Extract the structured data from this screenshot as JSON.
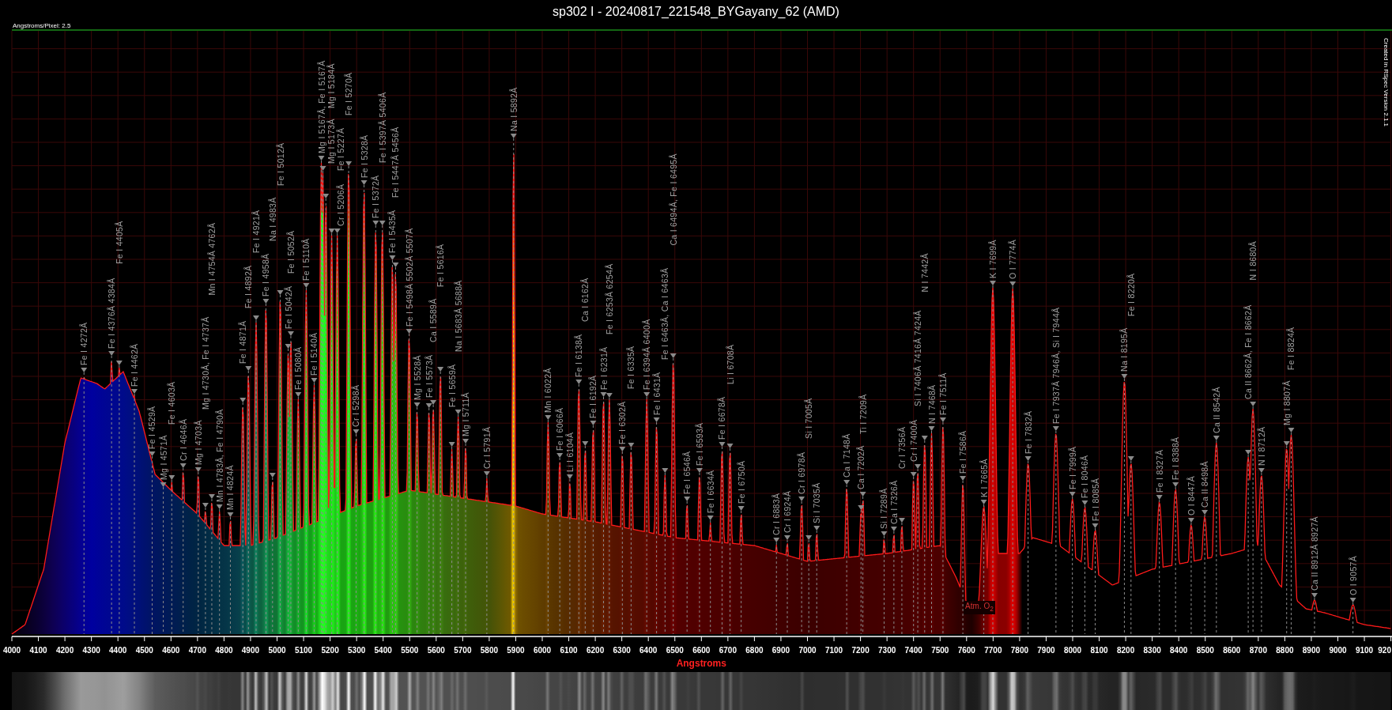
{
  "title": "sp302 I - 20240817_221548_BYGayany_62 (AMD)",
  "scale_note": "Angstroms/Pixel: 2.5",
  "credit": "Created in RSpec Version 2.1.1",
  "spectrum": {
    "xlabel": "Angstroms",
    "x_ticks": [
      "4000",
      "4100",
      "4200",
      "4300",
      "4400",
      "4500",
      "4600",
      "4700",
      "4800",
      "4900",
      "5000",
      "5100",
      "5200",
      "5300",
      "5400",
      "5500",
      "5600",
      "5700",
      "5800",
      "5900",
      "6000",
      "6100",
      "6200",
      "6300",
      "6400",
      "6500",
      "6600",
      "6700",
      "6800",
      "6900",
      "7000",
      "7100",
      "7200",
      "7300",
      "7400",
      "7500",
      "7600",
      "7700",
      "7800",
      "7900",
      "8000",
      "8100",
      "8200",
      "8300",
      "8400",
      "8500",
      "8600",
      "8700",
      "8800",
      "8900",
      "9000",
      "9100",
      "920"
    ],
    "band_note": "Atm. O$_{2}$",
    "line_labels": [
      "Fe I 4272Å",
      "Fe I 4376Å 4384Å",
      "Fe I 4405Å",
      "Fe I 4462Å",
      "Fe I 4529Å",
      "Mg I 4571Å",
      "Fe I 4603Å",
      "Cr I 4646Å",
      "Mg I 4703Å",
      "Mg I 4730Å, Fe I 4737Å",
      "Mn I 4754Å 4762Å",
      "Mn I 4783Å, Fe I 4790Å",
      "Mn I 4824Å",
      "Fe I 4871Å",
      "Fe I 4892Å",
      "Fe I 4921Å",
      "Fe I 4958Å",
      "Na I 4983Å",
      "Fe I 5012Å",
      "Fe I 5042Å",
      "Fe I 5052Å",
      "Fe I 5080Å",
      "Fe I 5110Å",
      "Fe I 5140Å",
      "Mg I 5167Å, Fe I 5167Å",
      "Mg I 5173Å",
      "Mg I 5184Å",
      "Cr I 5206Å",
      "Fe I 5227Å",
      "Fe I 5270Å",
      "Cr I 5298Å",
      "Fe I 5328Å",
      "Fe I 5372Å",
      "Fe I 5397Å 5406Å",
      "Fe I 5435Å",
      "Fe I 5447Å 5456Å",
      "Fe I 5498Å 5502Å 5507Å",
      "Mg I 5528Å",
      "Fe I 5573Å",
      "Ca I 5589Å",
      "Fe I 5616Å",
      "Fe I 5659Å",
      "Na I 5683Å 5688Å",
      "Mg I 5711Å",
      "Cr I 5791Å",
      "Na I 5892Å",
      "Mn I 6022Å",
      "Fe I 6066Å",
      "Li I 6104Å",
      "Fe I 6138Å",
      "Ca I 6162Å",
      "Fe I 6192Å",
      "Fe I 6231Å",
      "Fe I 6253Å 6254Å",
      "Fe I 6302Å",
      "Fe I 6335Å",
      "Fe I 6394Å 6400Å",
      "Fe I 6431Å",
      "Fe I 6463Å, Ca I 6463Å",
      "Ca I 6494Å, Fe I 6495Å",
      "Fe I 6546Å",
      "Fe I 6593Å",
      "Fe I 6634Å",
      "Fe I 6678Å",
      "Li I 6708Å",
      "Fe I 6750Å",
      "Cr I 6883Å",
      "Cr I 6924Å",
      "Cr I 6978Å",
      "Si I 7005Å",
      "Si I 7035Å",
      "Ca I 7148Å",
      "Ca I 7202Å",
      "Ti I 7209Å",
      "Si I 7289Å",
      "Ca I 7326Å",
      "Cr I 7356Å",
      "Cr I 7400Å",
      "Si I 7406Å 7416Å 7424Å",
      "N I 7442Å",
      "N I 7468Å",
      "Fe I 7511Å",
      "Fe I 7586Å",
      "K I 7665Å",
      "K I 7699Å",
      "O I 7774Å",
      "Fe I 7832Å",
      "Fe I 7937Å 7946Å, Si I 7944Å",
      "Fe I 7999Å",
      "Fe I 8046Å",
      "Fe I 8085Å",
      "Na I 8195Å",
      "Fe I 8220Å",
      "Fe I 8327Å",
      "Fe I 8388Å",
      "O I 8447Å",
      "Ca II 8498Å",
      "Ca II 8542Å",
      "Ca II 8662Å, Fe I 8662Å",
      "N I 8680Å",
      "N I 8712Å",
      "Mg I 8807Å",
      "Fe I 8824Å",
      "Ca II 8912Å 8927Å",
      "O I 9057Å"
    ]
  }
}
